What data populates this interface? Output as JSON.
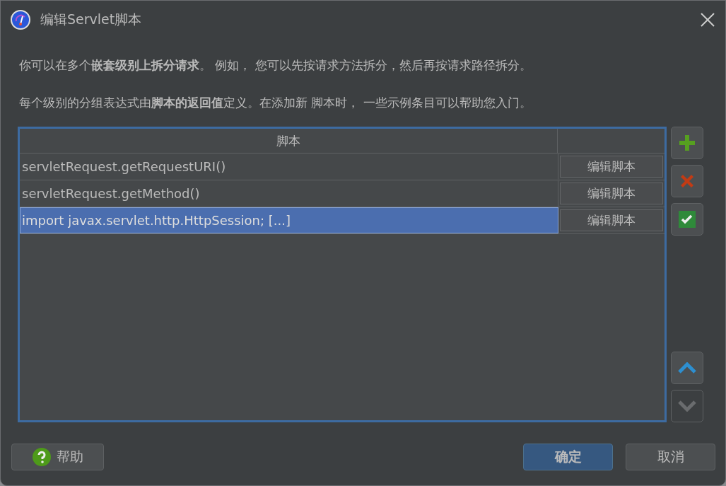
{
  "window": {
    "title": "编辑Servlet脚本"
  },
  "description": [
    "你可以在多个**嵌套级别上拆分请求**。 例如， 您可以先按请求方法拆分，然后再按请求路径拆分。",
    "每个级别的分组表达式由**脚本的返回值**定义。在添加新 脚本时， 一些示例条目可以帮助您入门。"
  ],
  "table": {
    "columns": [
      "脚本"
    ],
    "rows": [
      {
        "script": "servletRequest.getRequestURI()",
        "action": "编辑脚本",
        "selected": false
      },
      {
        "script": "servletRequest.getMethod()",
        "action": "编辑脚本",
        "selected": false
      },
      {
        "script": "import javax.servlet.http.HttpSession; [...]",
        "action": "编辑脚本",
        "selected": true
      }
    ]
  },
  "side_buttons": [
    {
      "kind": "add",
      "disabled": false
    },
    {
      "kind": "remove",
      "disabled": false
    },
    {
      "kind": "check",
      "disabled": false
    },
    {
      "kind": "up",
      "disabled": false
    },
    {
      "kind": "down",
      "disabled": true
    }
  ],
  "buttons": [
    {
      "label": "帮助",
      "kind": "help"
    },
    {
      "label": "确定",
      "kind": "default"
    },
    {
      "label": "取消",
      "kind": "normal"
    }
  ]
}
